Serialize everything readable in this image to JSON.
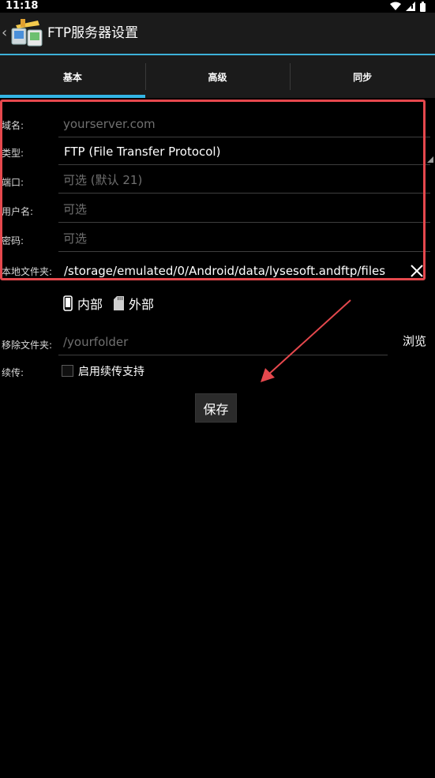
{
  "status_bar": {
    "time": "11:18"
  },
  "action_bar": {
    "back_glyph": "‹",
    "title": "FTP服务器设置"
  },
  "tabs": [
    {
      "label": "基本",
      "active": true
    },
    {
      "label": "高级",
      "active": false
    },
    {
      "label": "同步",
      "active": false
    }
  ],
  "form": {
    "host": {
      "label": "域名:",
      "placeholder": "yourserver.com",
      "value": ""
    },
    "type": {
      "label": "类型:",
      "value": "FTP (File Transfer Protocol)"
    },
    "port": {
      "label": "端口:",
      "placeholder": "可选 (默认 21)",
      "value": ""
    },
    "username": {
      "label": "用户名:",
      "placeholder": "可选",
      "value": ""
    },
    "password": {
      "label": "密码:",
      "placeholder": "可选",
      "value": ""
    },
    "local_folder": {
      "label": "本地文件夹:",
      "value": "/storage/emulated/0/Android/data/lysesoft.andftp/files"
    },
    "storage_options": {
      "internal": "内部",
      "external": "外部"
    },
    "remote_folder": {
      "label": "移除文件夹:",
      "placeholder": "/yourfolder",
      "value": ""
    },
    "browse_label": "浏览",
    "resume": {
      "label": "续传:",
      "checkbox_label": "启用续传支持",
      "checked": false
    }
  },
  "save_button": "保存",
  "colors": {
    "accent_blue": "#33b5e5",
    "highlight_red": "#e5484d",
    "background": "#000000",
    "bar": "#1b1b1b"
  }
}
